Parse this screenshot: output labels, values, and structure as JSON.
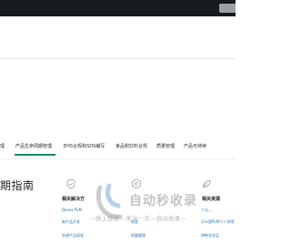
{
  "nav": {
    "items": [
      {
        "label": "理",
        "active": false
      },
      {
        "label": "产品生命周期管理",
        "active": true
      },
      {
        "label": "EHS合规和SDS编写",
        "active": false
      },
      {
        "label": "食品和饮料合规",
        "active": false
      },
      {
        "label": "质量管理",
        "active": false
      },
      {
        "label": "产品可持续",
        "active": false
      }
    ]
  },
  "page_title": "期指南",
  "columns": [
    {
      "icon": "shield-icon",
      "heading": "相关解决方",
      "links": [
        "Devex PLM",
        "新产品开发",
        "合规产品研发"
      ]
    },
    {
      "icon": "hexagon-icon",
      "heading": "",
      "links": [
        "标签",
        "质量管理"
      ]
    },
    {
      "icon": "leaf-icon",
      "heading": "相关资源",
      "links": [
        "人与…",
        "什么是PLM个人学得",
        "特种化学品"
      ]
    }
  ],
  "watermark": {
    "brand": "自动秒收录",
    "url": "—做上链接—来访一次—自动收录—"
  },
  "colors": {
    "topbar": "#161a1c",
    "accent": "#0f8a5f",
    "link": "#1a6fb3"
  }
}
